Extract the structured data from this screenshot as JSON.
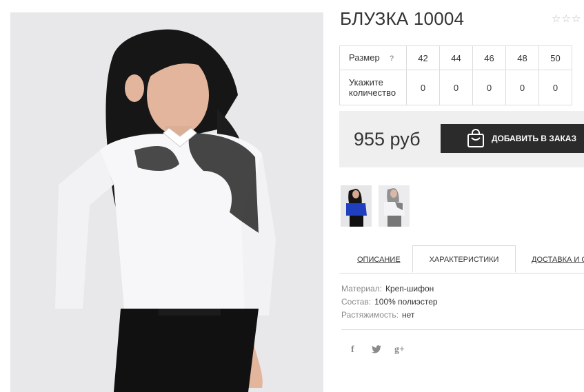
{
  "product": {
    "title": "БЛУЗКА 10004",
    "rating_stars": "☆☆☆",
    "price": "955 руб",
    "add_to_order_label": "ДОБАВИТЬ В ЗАКАЗ"
  },
  "sizes": {
    "size_label": "Размер",
    "help_symbol": "?",
    "qty_label_line1": "Укажите",
    "qty_label_line2": "количество",
    "values": [
      "42",
      "44",
      "46",
      "48",
      "50"
    ],
    "quantities": [
      "0",
      "0",
      "0",
      "0",
      "0"
    ]
  },
  "tabs": {
    "description": "ОПИСАНИЕ",
    "characteristics": "ХАРАКТЕРИСТИКИ",
    "delivery": "ДОСТАВКА И О"
  },
  "specs": [
    {
      "key": "Материал:",
      "value": "Креп-шифон"
    },
    {
      "key": "Состав:",
      "value": "100% полиэстер"
    },
    {
      "key": "Растяжимость:",
      "value": "нет"
    }
  ],
  "social": {
    "facebook": "f",
    "twitter": "🐦",
    "googleplus": "g+"
  },
  "colors": {
    "button_bg": "#2b2b2b",
    "price_box_bg": "#efefef",
    "thumb_blue": "#1f3fbf"
  }
}
